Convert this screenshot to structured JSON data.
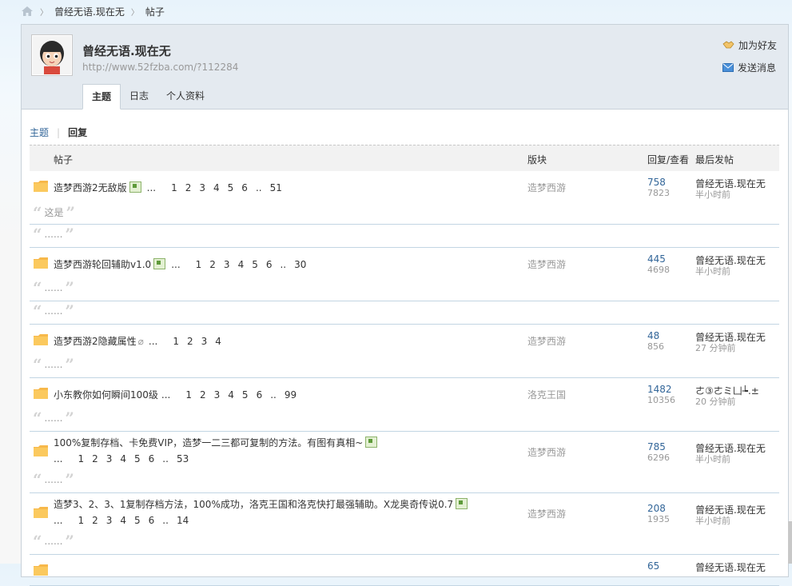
{
  "breadcrumb": {
    "home_icon": "home-icon",
    "items": [
      "曾经无语.现在无",
      "帖子"
    ]
  },
  "profile": {
    "name": "曾经无语.现在无",
    "url": "http://www.52fzba.com/?112284",
    "add_friend": "加为好友",
    "send_message": "发送消息"
  },
  "tabs": [
    "主题",
    "日志",
    "个人资料"
  ],
  "subtabs": {
    "topics": "主题",
    "replies": "回复"
  },
  "columns": {
    "post": "帖子",
    "forum": "版块",
    "stats": "回复/查看",
    "last": "最后发帖"
  },
  "posts": [
    {
      "title": "造梦西游2无敌版",
      "icon": "image",
      "ellipsis": "...",
      "pages": [
        "1",
        "2",
        "3",
        "4",
        "5",
        "6",
        "..",
        "51"
      ],
      "pages_line2": false,
      "forum": "造梦西游",
      "replies": "758",
      "views": "7823",
      "last_by": "曾经无语.现在无",
      "last_time": "半小时前",
      "quotes": [
        "这是",
        "......"
      ]
    },
    {
      "title": "造梦西游轮回辅助v1.0",
      "icon": "image",
      "ellipsis": "...",
      "pages": [
        "1",
        "2",
        "3",
        "4",
        "5",
        "6",
        "..",
        "30"
      ],
      "pages_line2": false,
      "forum": "造梦西游",
      "replies": "445",
      "views": "4698",
      "last_by": "曾经无语.现在无",
      "last_time": "半小时前",
      "quotes": [
        "......",
        "......"
      ]
    },
    {
      "title": "造梦西游2隐藏属性",
      "icon": "attach",
      "ellipsis": "...",
      "pages": [
        "1",
        "2",
        "3",
        "4"
      ],
      "pages_line2": false,
      "forum": "造梦西游",
      "replies": "48",
      "views": "856",
      "last_by": "曾经无语.现在无",
      "last_time": "27 分钟前",
      "quotes": [
        "......"
      ]
    },
    {
      "title": "小东教你如何瞬间100级",
      "icon": "none",
      "ellipsis": "...",
      "pages": [
        "1",
        "2",
        "3",
        "4",
        "5",
        "6",
        "..",
        "99"
      ],
      "pages_line2": false,
      "forum": "洛克王国",
      "replies": "1482",
      "views": "10356",
      "last_by": "ㄜ③ㄜミ凵┶.±",
      "last_time": "20 分钟前",
      "quotes": [
        "......"
      ]
    },
    {
      "title": "100%复制存档、卡免费VIP，造梦一二三都可复制的方法。有图有真相~",
      "icon": "image",
      "ellipsis": "...",
      "pages": [
        "1",
        "2",
        "3",
        "4",
        "5",
        "6",
        "..",
        "53"
      ],
      "pages_line2": true,
      "forum": "造梦西游",
      "replies": "785",
      "views": "6296",
      "last_by": "曾经无语.现在无",
      "last_time": "半小时前",
      "quotes": [
        "......"
      ]
    },
    {
      "title": "造梦3、2、3、1复制存档方法，100%成功，洛克王国和洛克快打最强辅助。X龙奥奇传说0.7",
      "icon": "image",
      "ellipsis": "...",
      "pages": [
        "1",
        "2",
        "3",
        "4",
        "5",
        "6",
        "..",
        "14"
      ],
      "pages_line2": true,
      "forum": "造梦西游",
      "replies": "208",
      "views": "1935",
      "last_by": "曾经无语.现在无",
      "last_time": "半小时前",
      "quotes": [
        "......"
      ]
    },
    {
      "title": "",
      "icon": "none",
      "ellipsis": "",
      "pages": [],
      "pages_line2": false,
      "forum": "",
      "replies": "65",
      "views": "",
      "last_by": "曾经无语.现在无",
      "last_time": "",
      "quotes": []
    }
  ]
}
